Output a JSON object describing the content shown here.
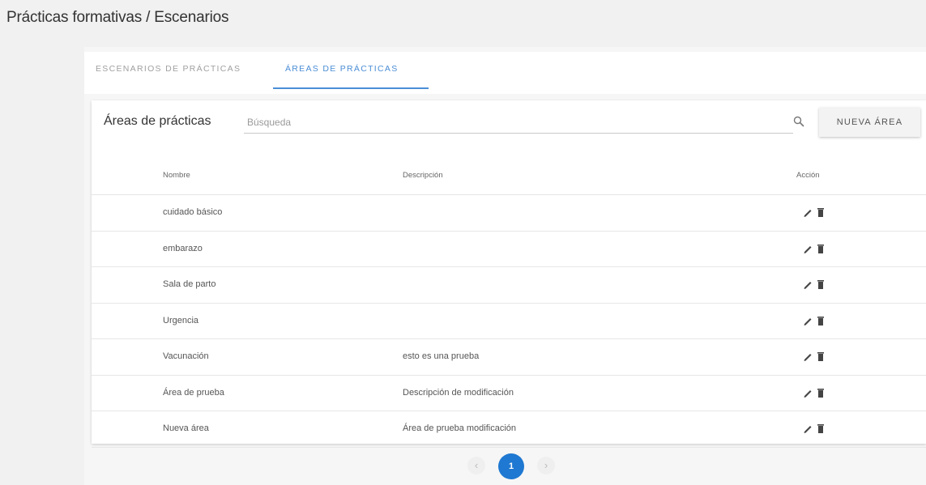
{
  "page": {
    "title": "Prácticas formativas / Escenarios"
  },
  "tabs": [
    {
      "label": "ESCENARIOS DE PRÁCTICAS",
      "active": false
    },
    {
      "label": "ÁREAS DE PRÁCTICAS",
      "active": true
    }
  ],
  "card": {
    "title": "Áreas de prácticas",
    "search_placeholder": "Búsqueda",
    "new_button_label": "NUEVA ÁREA"
  },
  "table": {
    "columns": {
      "name": "Nombre",
      "description": "Descripción",
      "action": "Acción"
    },
    "rows": [
      {
        "name": "cuidado básico",
        "description": ""
      },
      {
        "name": "embarazo",
        "description": ""
      },
      {
        "name": "Sala de parto",
        "description": ""
      },
      {
        "name": "Urgencia",
        "description": ""
      },
      {
        "name": "Vacunación",
        "description": "esto es una prueba"
      },
      {
        "name": "Área de prueba",
        "description": "Descripción de modificación"
      },
      {
        "name": "Nueva área",
        "description": "Área de prueba modificación"
      }
    ]
  },
  "pagination": {
    "current_page": "1",
    "prev_symbol": "‹",
    "next_symbol": "›"
  },
  "colors": {
    "accent": "#4b8ed6",
    "pagination_active": "#1f78d1",
    "header_bg": "#f1f1f1"
  },
  "icons": {
    "search": "search-icon",
    "edit": "pencil-icon",
    "delete": "trash-icon"
  }
}
